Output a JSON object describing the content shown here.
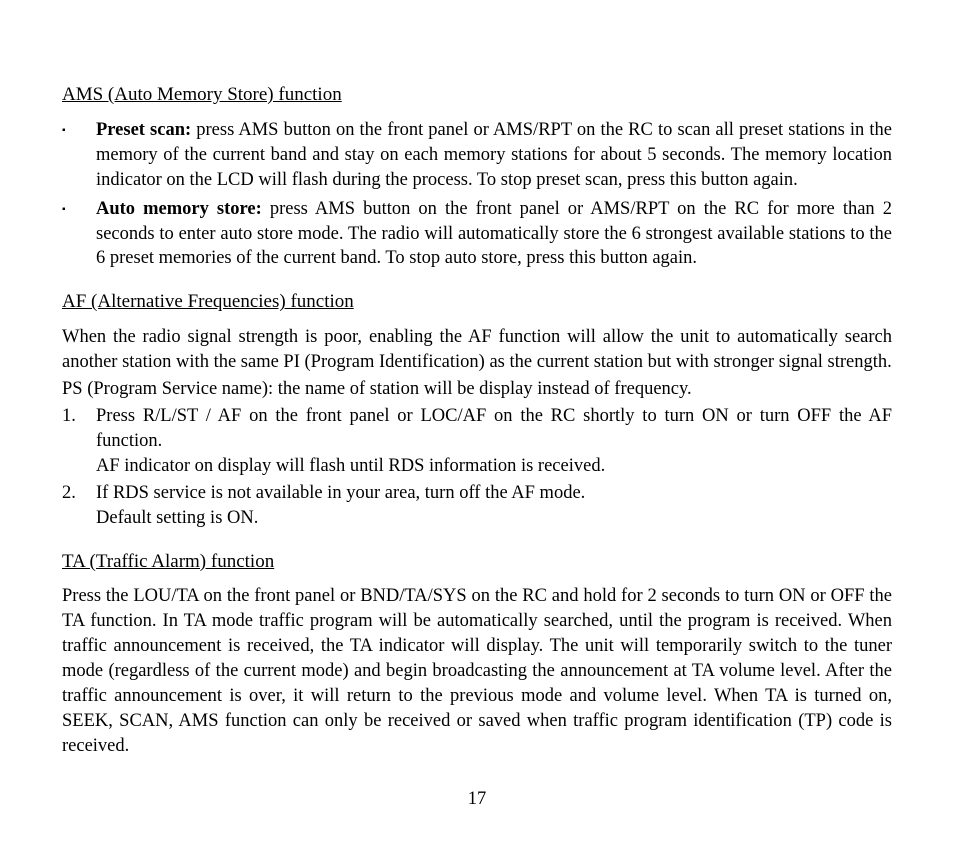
{
  "sections": {
    "ams": {
      "heading": "AMS (Auto Memory Store) function",
      "bullets": [
        {
          "bold": "Preset scan:",
          "text": " press AMS button on the front panel or AMS/RPT on the RC to scan all preset stations in the memory of the current band and stay on each memory stations for about 5 seconds. The memory location indicator on the LCD will flash during the process. To stop preset scan, press this button again."
        },
        {
          "bold": "Auto memory store:",
          "text": " press AMS button on the front panel or AMS/RPT on the RC for more than 2 seconds to enter auto store mode. The radio will automatically store the 6 strongest available stations to the 6 preset memories of the current band. To stop auto store, press this button again."
        }
      ]
    },
    "af": {
      "heading": "AF (Alternative Frequencies) function",
      "intro_lines": [
        "When the radio signal strength is poor, enabling the AF function will allow the unit to automatically search another station with the same PI (Program Identification) as the current station but with stronger signal strength.",
        "PS (Program Service name): the name of station will be display instead of frequency."
      ],
      "numbered": [
        {
          "line1": "Press R/L/ST / AF on the front panel or LOC/AF on the RC shortly to turn ON or turn OFF the AF function.",
          "line2": "AF indicator on display will flash until RDS information is received."
        },
        {
          "line1": "If RDS service is not available in your area, turn off the AF mode.",
          "line2": "Default setting is ON."
        }
      ]
    },
    "ta": {
      "heading": "TA (Traffic Alarm) function",
      "body": "Press the LOU/TA on the front panel or BND/TA/SYS on the RC and hold for 2 seconds to turn ON or OFF the TA function. In TA mode traffic program will be automatically searched, until the program is received. When traffic announcement is received, the TA indicator will display. The unit will temporarily switch to the tuner mode (regardless of the current mode) and begin broadcasting the announcement at TA volume level. After the traffic announcement is over, it will return to the previous mode and volume level. When TA is turned on, SEEK, SCAN, AMS function can only be received or saved when traffic program identification (TP) code is received."
    }
  },
  "page_number": "17"
}
